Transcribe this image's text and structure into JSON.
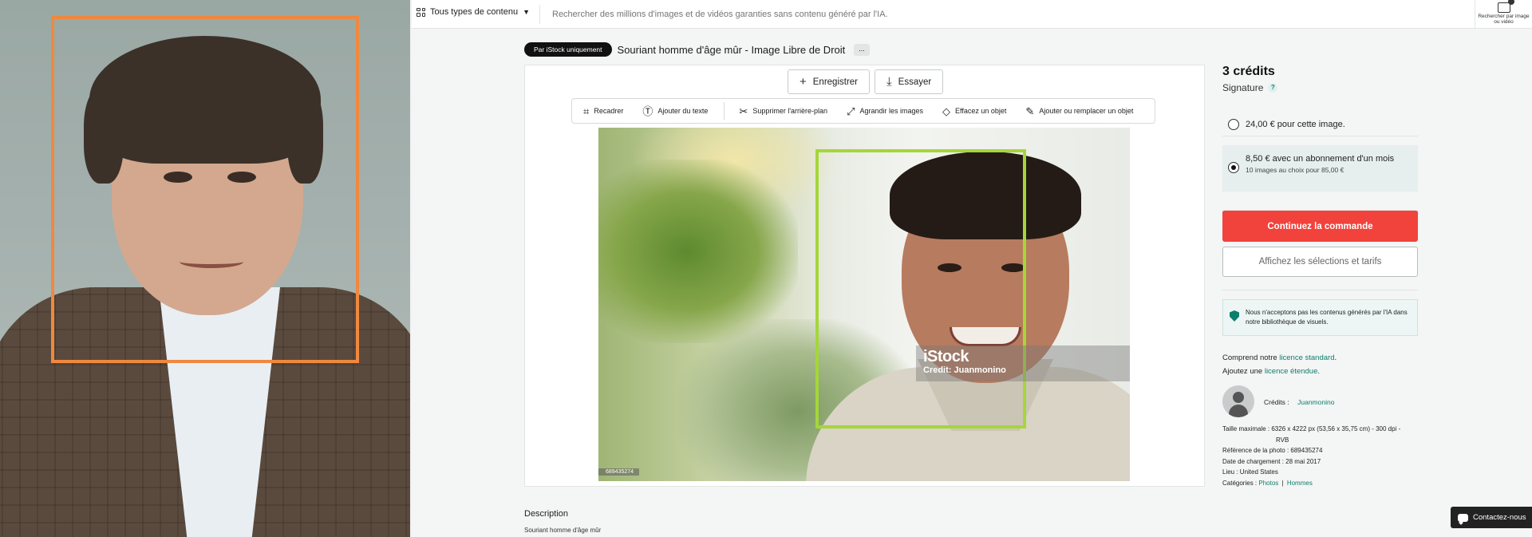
{
  "topbar": {
    "content_type_label": "Tous types de contenu",
    "search_placeholder": "Rechercher des millions d'images et de vidéos garanties sans contenu généré par l'IA.",
    "image_search_label": "Rechercher par image ou vidéo"
  },
  "header": {
    "badge": "Par iStock uniquement",
    "title": "Souriant homme d'âge mûr - Image Libre de Droit",
    "more": "..."
  },
  "actions": {
    "save": "Enregistrer",
    "try": "Essayer"
  },
  "tools": [
    {
      "label": "Recadrer",
      "icon": "crop-icon"
    },
    {
      "label": "Ajouter du texte",
      "icon": "text-icon"
    },
    {
      "label": "Supprimer l'arrière-plan",
      "icon": "scissors-icon"
    },
    {
      "label": "Agrandir les images",
      "icon": "expand-icon"
    },
    {
      "label": "Effacez un objet",
      "icon": "eraser-icon"
    },
    {
      "label": "Ajouter ou remplacer un objet",
      "icon": "replace-icon"
    }
  ],
  "photo": {
    "watermark_logo": "iStock",
    "watermark_credit": "Credit: Juanmonino",
    "image_id": "689435274",
    "face_box_color": "#a5d63a"
  },
  "left_image": {
    "face_box_color": "#f0883e"
  },
  "description": {
    "heading": "Description",
    "text": "Souriant homme d'âge mûr"
  },
  "pricing": {
    "credits": "3 crédits",
    "tier": "Signature",
    "help": "?",
    "option1": "24,00 € pour cette image.",
    "option2_main": "8,50 € avec un abonnement d'un mois",
    "option2_sub": "10 images au choix pour 85,00 €",
    "selected_option": 2,
    "cta_primary": "Continuez la commande",
    "cta_secondary": "Affichez les sélections et tarifs",
    "accent_color": "#f2423c"
  },
  "ai_notice": "Nous n'acceptons pas les contenus générés par l'IA dans notre bibliothèque de visuels.",
  "license": {
    "line1_prefix": "Comprend notre",
    "line1_link": "licence standard",
    "line1_suffix": ".",
    "line2_prefix": "Ajoutez une",
    "line2_link": "licence étendue",
    "line2_suffix": "."
  },
  "credit": {
    "label": "Crédits :",
    "name": "Juanmonino"
  },
  "meta": {
    "size_line1": "Taille maximale : 6326 x 4222 px (53,56 x 35,75 cm) - 300 dpi -",
    "size_line2": "RVB",
    "ref": "Référence de la photo : 689435274",
    "date": "Date de chargement : 28 mai 2017",
    "place": "Lieu : United States",
    "categories_label": "Catégories :",
    "category1": "Photos",
    "sep": "|",
    "category2": "Hommes"
  },
  "contact": "Contactez-nous"
}
